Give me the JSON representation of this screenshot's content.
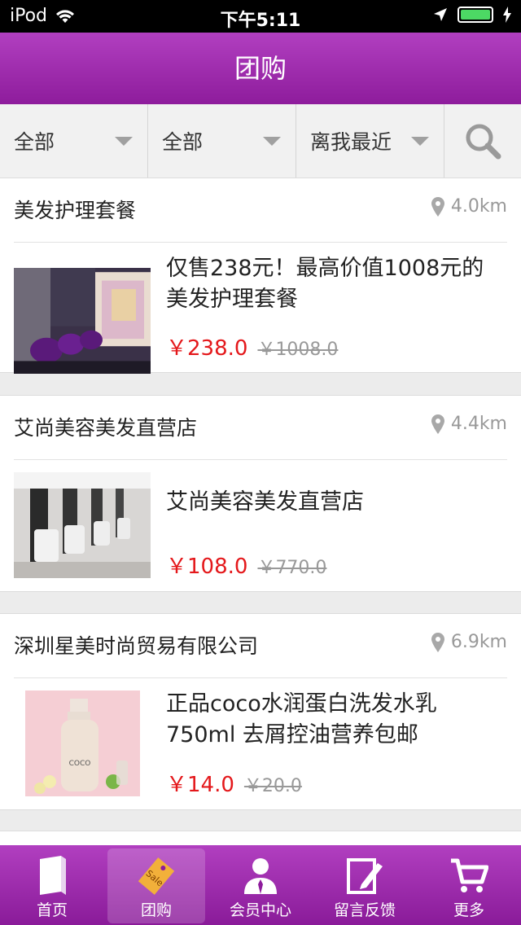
{
  "status": {
    "carrier": "iPod",
    "time": "下午5:11"
  },
  "nav": {
    "title": "团购"
  },
  "filters": [
    {
      "label": "全部"
    },
    {
      "label": "全部"
    },
    {
      "label": "离我最近"
    }
  ],
  "deals": [
    {
      "title": "美发护理套餐",
      "distance": "4.0km",
      "desc": "仅售238元！最高价值1008元的美发护理套餐",
      "price": "￥238.0",
      "old_price": "￥1008.0"
    },
    {
      "title": "艾尚美容美发直营店",
      "distance": "4.4km",
      "desc": "艾尚美容美发直营店",
      "price": "￥108.0",
      "old_price": "￥770.0"
    },
    {
      "title": "深圳星美时尚贸易有限公司",
      "distance": "6.9km",
      "desc": "正品coco水润蛋白洗发水乳750ml 去屑控油营养包邮",
      "price": "￥14.0",
      "old_price": "￥20.0",
      "product_text": "COCO"
    }
  ],
  "tabs": [
    {
      "label": "首页",
      "icon": "book-icon"
    },
    {
      "label": "团购",
      "icon": "sale-tag-icon",
      "active": true,
      "tag_text": "Sale"
    },
    {
      "label": "会员中心",
      "icon": "member-icon"
    },
    {
      "label": "留言反馈",
      "icon": "edit-note-icon"
    },
    {
      "label": "更多",
      "icon": "cart-icon"
    }
  ]
}
